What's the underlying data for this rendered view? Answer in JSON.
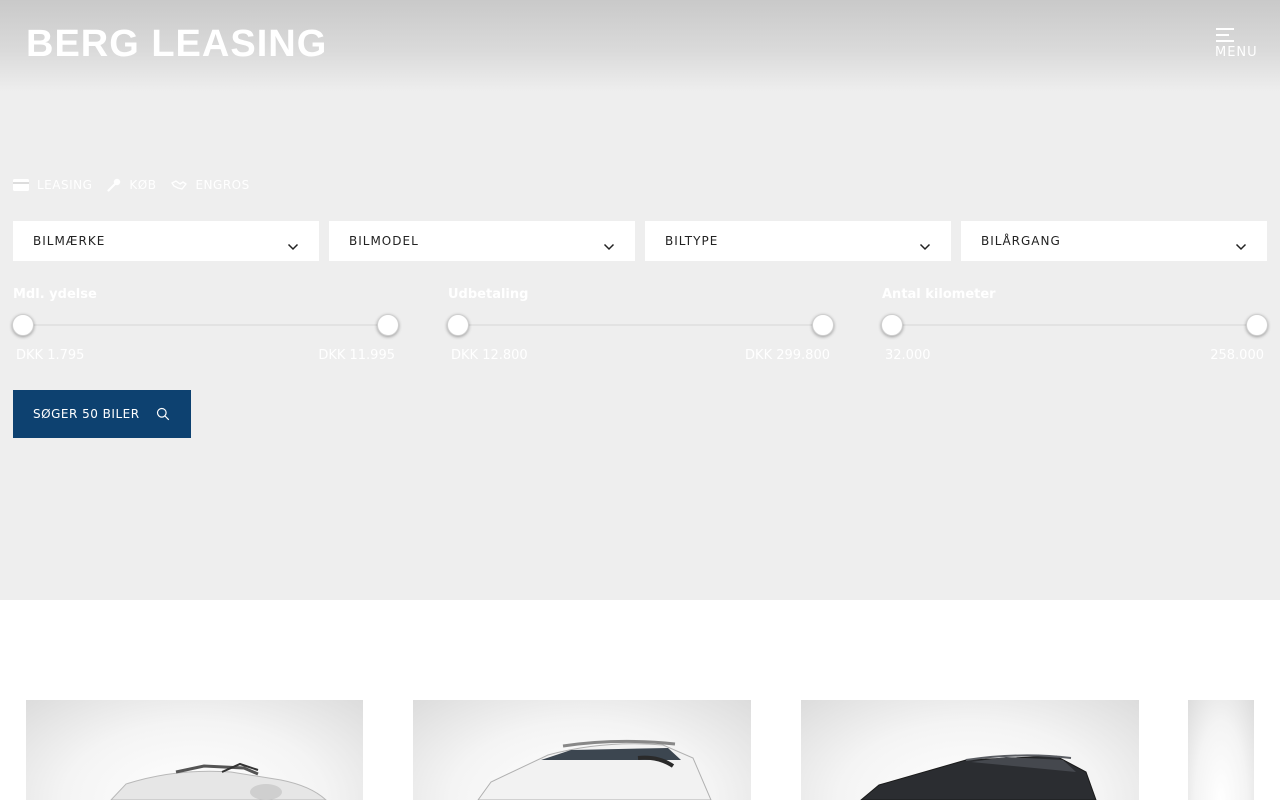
{
  "header": {
    "logo_text": "BERG LEASING",
    "menu_label": "MENU"
  },
  "tabs": [
    {
      "label": "LEASING",
      "icon": "card-icon"
    },
    {
      "label": "KØB",
      "icon": "key-icon"
    },
    {
      "label": "ENGROS",
      "icon": "handshake-icon"
    }
  ],
  "filters": [
    {
      "label": "BILMÆRKE"
    },
    {
      "label": "BILMODEL"
    },
    {
      "label": "BILTYPE"
    },
    {
      "label": "BILÅRGANG"
    }
  ],
  "sliders": [
    {
      "label": "Mdl. ydelse",
      "min": "DKK 1.795",
      "max": "DKK 11.995",
      "range_fraction": [
        0,
        1
      ]
    },
    {
      "label": "Udbetaling",
      "min": "DKK 12.800",
      "max": "DKK 299.800",
      "range_fraction": [
        0,
        1
      ]
    },
    {
      "label": "Antal kilometer",
      "min": "32.000",
      "max": "258.000",
      "range_fraction": [
        0,
        1
      ]
    }
  ],
  "search": {
    "label": "SØGER 50 BILER",
    "icon": "search-icon"
  },
  "cars": [
    {
      "image": "white-convertible"
    },
    {
      "image": "white-suv"
    },
    {
      "image": "black-suv"
    },
    {
      "image": "partial-card"
    }
  ],
  "colors": {
    "hero_bg": "#eeeeee",
    "primary_button": "#0d4170",
    "text_on_hero": "#ffffff"
  }
}
